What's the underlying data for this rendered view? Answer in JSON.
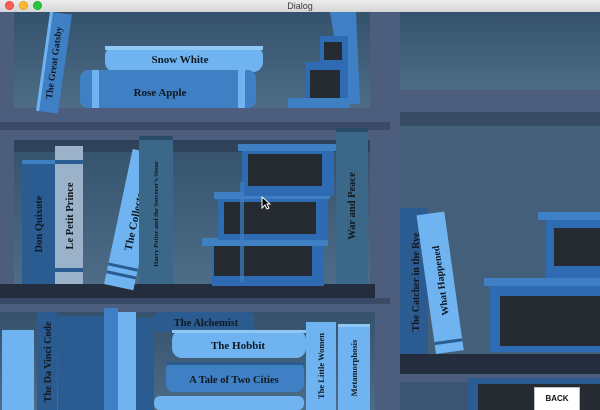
{
  "window": {
    "title": "Dialog"
  },
  "books": {
    "great_gatsby": "The Great Gatsby",
    "snow_white": "Snow White",
    "rose_apple": "Rose Apple",
    "don_quixote": "Don Quixote",
    "le_petit_prince": "Le Petit Prince",
    "the_collector": "The Collector",
    "harry_potter": "Harry Potter and the Sorcerer's Stone",
    "war_and_peace": "War and Peace",
    "catcher_in_the_rye": "The Catcher in the Rye",
    "what_happened": "What Happened",
    "da_vinci_code": "The Da Vinci Code",
    "the_alchemist": "The Alchemist",
    "the_hobbit": "The Hobbit",
    "tale_of_two_cities": "A Tale of Two Cities",
    "the_little_women": "The Little Women",
    "metamorphosis": "Metamorphosis"
  },
  "buttons": {
    "back": "BACK"
  },
  "colors": {
    "wall": "#41607c",
    "shelf_frame": "#4c5d7e",
    "shelf_plank": "#2a3346",
    "book_light": "#6fb4f0",
    "book_mid": "#3f7fc4",
    "book_dark": "#2a5b91"
  }
}
